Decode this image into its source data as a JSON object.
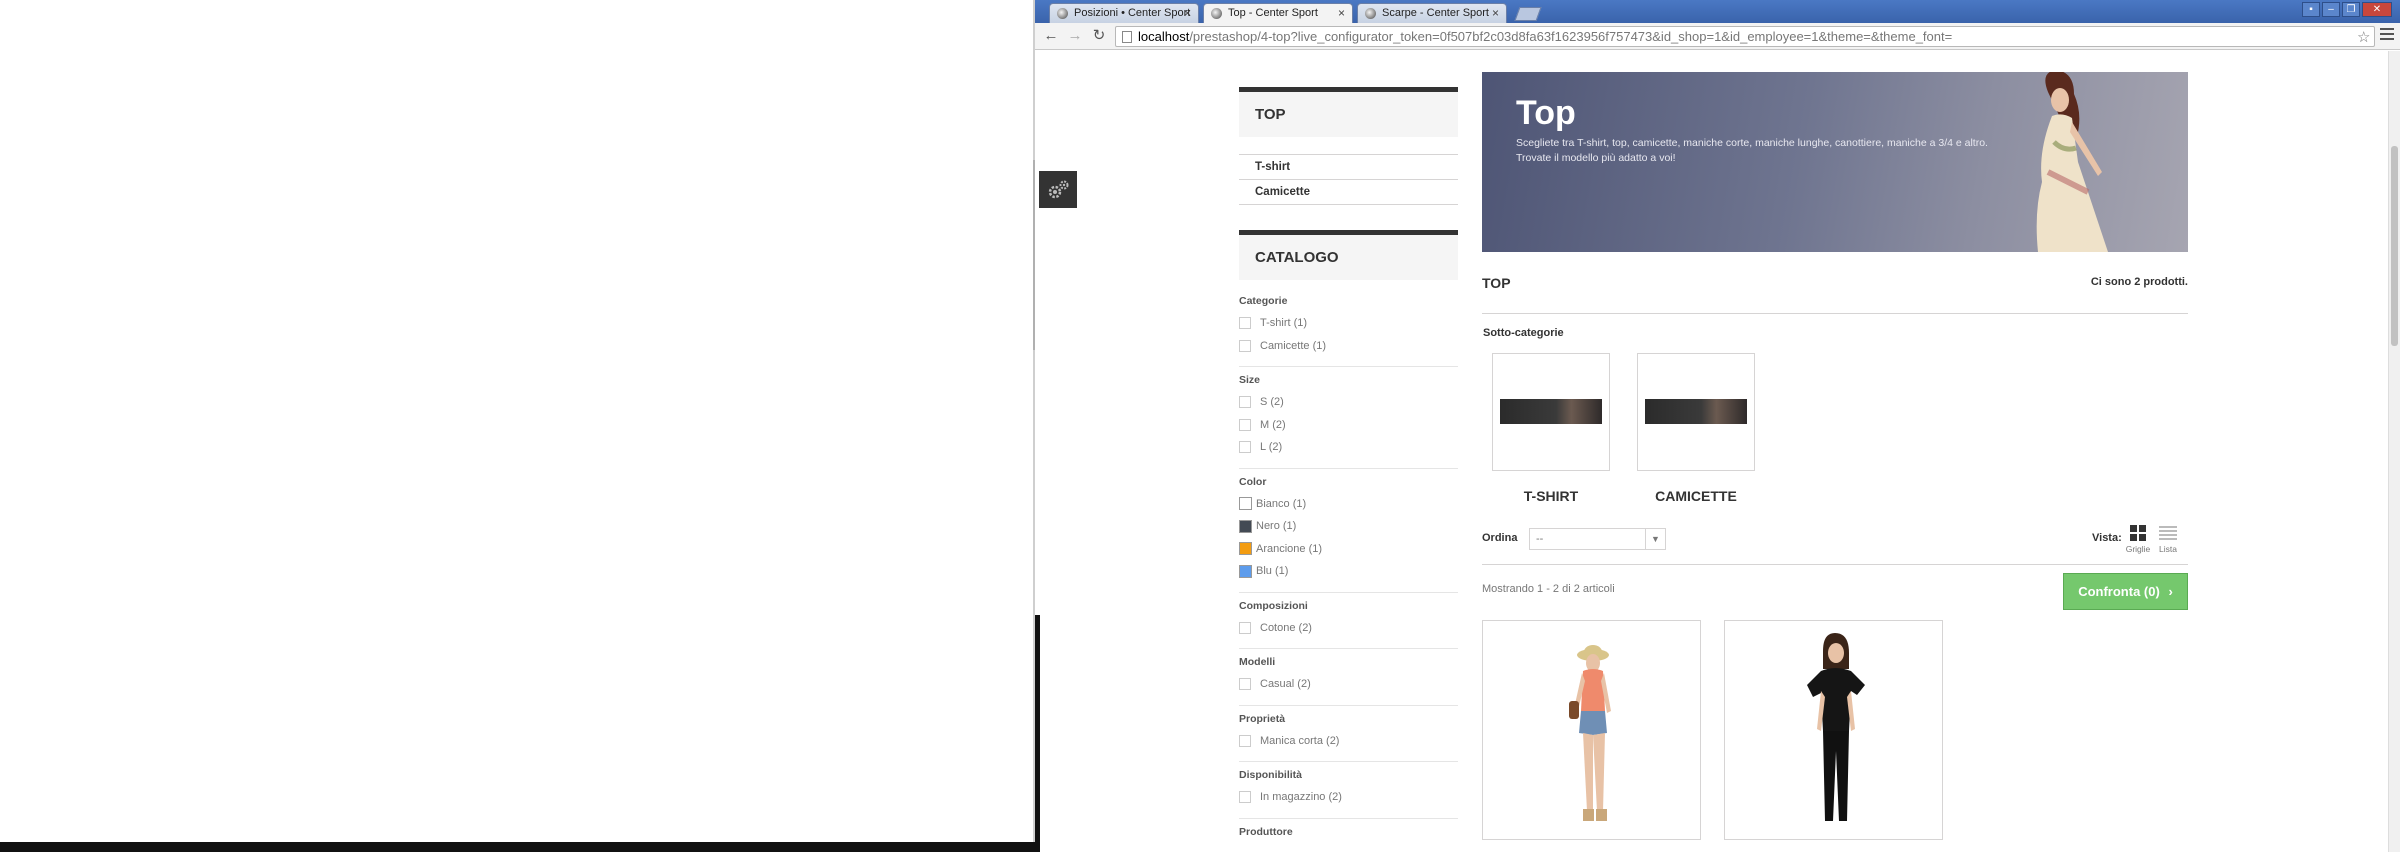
{
  "browser": {
    "tabs": [
      {
        "label": "Posizioni • Center Sport",
        "active": false
      },
      {
        "label": "Top - Center Sport",
        "active": true
      },
      {
        "label": "Scarpe - Center Sport",
        "active": false
      }
    ],
    "url_host": "localhost",
    "url_path": "/prestashop/4-top?live_configurator_token=0f507bf2c03d8fa63f1623956f757473&id_shop=1&id_employee=1&theme=&theme_font="
  },
  "sidebar": {
    "top_block": {
      "title": "TOP",
      "items": [
        "T-shirt",
        "Camicette"
      ]
    },
    "catalog_block": {
      "title": "CATALOGO",
      "groups": [
        {
          "title": "Categorie",
          "items": [
            "T-shirt (1)",
            "Camicette (1)"
          ]
        },
        {
          "title": "Size",
          "items": [
            "S (2)",
            "M (2)",
            "L (2)"
          ]
        },
        {
          "title": "Color",
          "items": [
            {
              "label": "Bianco (1)",
              "color": "#ffffff"
            },
            {
              "label": "Nero (1)",
              "color": "#434a54"
            },
            {
              "label": "Arancione (1)",
              "color": "#f39c11"
            },
            {
              "label": "Blu (1)",
              "color": "#5d9cec"
            }
          ]
        },
        {
          "title": "Composizioni",
          "items": [
            "Cotone (2)"
          ]
        },
        {
          "title": "Modelli",
          "items": [
            "Casual (2)"
          ]
        },
        {
          "title": "Proprietà",
          "items": [
            "Manica corta (2)"
          ]
        },
        {
          "title": "Disponibilità",
          "items": [
            "In magazzino (2)"
          ]
        },
        {
          "title": "Produttore",
          "items": []
        }
      ]
    }
  },
  "main": {
    "banner": {
      "title": "Top",
      "description_line1": "Sceglietе tra T-shirt, top, camicette, maniche corte, maniche lunghe, canottiere, maniche a 3/4 e altro.",
      "description_line2": "Trovate il modello più adatto a voi!"
    },
    "category_name": "TOP",
    "product_count": "Ci sono 2 prodotti.",
    "subcategories_heading": "Sotto-categorie",
    "subcategories": [
      "T-SHIRT",
      "CAMICETTE"
    ],
    "sort_label": "Ordina",
    "sort_value": "--",
    "view_label": "Vista:",
    "view_grid": "Griglie",
    "view_list": "Lista",
    "showing": "Mostrando 1 - 2 di 2 articoli",
    "compare_button": "Confronta (0)"
  }
}
